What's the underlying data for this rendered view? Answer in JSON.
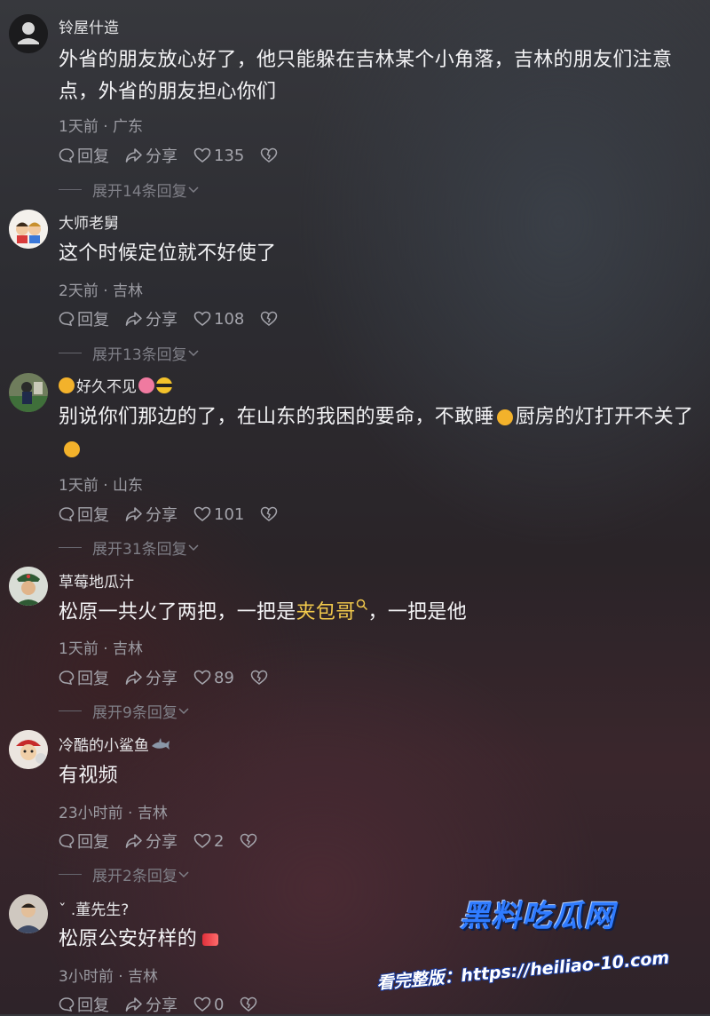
{
  "actions": {
    "reply": "回复",
    "share": "分享"
  },
  "comments": [
    {
      "user": "铃屋什造",
      "text": "外省的朋友放心好了，他只能躲在吉林某个小角落，吉林的朋友们注意点，外省的朋友担心你们",
      "meta": "1天前 · 广东",
      "likes": "135",
      "expand": "展开14条回复"
    },
    {
      "user": "大师老舅",
      "text": "这个时候定位就不好使了",
      "meta": "2天前 · 吉林",
      "likes": "108",
      "expand": "展开13条回复"
    },
    {
      "user": "好久不见",
      "text_a": "别说你们那边的了，在山东的我困的要命，不敢睡",
      "text_b": "厨房的灯打开不关了",
      "meta": "1天前 · 山东",
      "likes": "101",
      "expand": "展开31条回复"
    },
    {
      "user": "草莓地瓜汁",
      "text_a": "松原一共火了两把，一把是",
      "keyword": "夹包哥",
      "text_b": "，一把是他",
      "meta": "1天前 · 吉林",
      "likes": "89",
      "expand": "展开9条回复"
    },
    {
      "user": "冷酷的小鲨鱼",
      "text": "有视频",
      "meta": "23小时前 · 吉林",
      "likes": "2",
      "expand": "展开2条回复"
    },
    {
      "user": "ˇ .董先生?",
      "text": "松原公安好样的",
      "meta": "3小时前 · 吉林",
      "likes": "0"
    }
  ],
  "watermark": {
    "title": "黑料吃瓜网",
    "url": "看完整版：https://heiliao-10.com"
  },
  "colors": {
    "keyword": "#f2c94c",
    "watermark_blue": "#2f7bff",
    "text": "#f3f3f5",
    "muted": "#9c9ca3"
  }
}
